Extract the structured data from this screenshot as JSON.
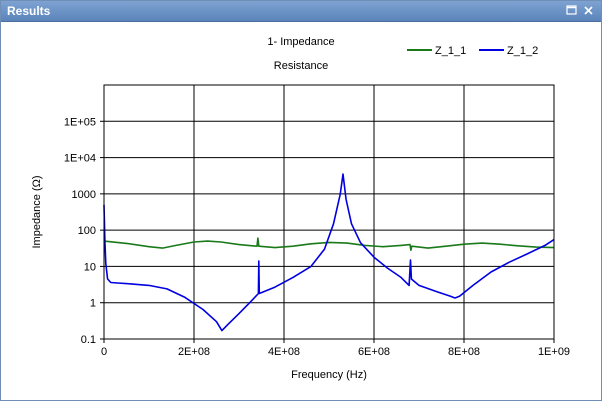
{
  "window": {
    "title": "Results"
  },
  "chart_data": {
    "type": "line",
    "title": "1- Impedance",
    "subtitle": "Resistance",
    "xlabel": "Frequency (Hz)",
    "ylabel": "Impedance (Ω)",
    "xlim": [
      0,
      1000000000
    ],
    "ylim": [
      0.1,
      1000000
    ],
    "yscale": "log",
    "grid": true,
    "legend_position": "top-right",
    "x_ticks": [
      {
        "value": 0,
        "label": "0"
      },
      {
        "value": 200000000,
        "label": "2E+08"
      },
      {
        "value": 400000000,
        "label": "4E+08"
      },
      {
        "value": 600000000,
        "label": "6E+08"
      },
      {
        "value": 800000000,
        "label": "8E+08"
      },
      {
        "value": 1000000000,
        "label": "1E+09"
      }
    ],
    "y_ticks": [
      {
        "value": 0.1,
        "label": "0.1"
      },
      {
        "value": 1,
        "label": "1"
      },
      {
        "value": 10,
        "label": "10"
      },
      {
        "value": 100,
        "label": "100"
      },
      {
        "value": 1000,
        "label": "1000"
      },
      {
        "value": 10000,
        "label": "1E+04"
      },
      {
        "value": 100000,
        "label": "1E+05"
      }
    ],
    "series": [
      {
        "name": "Z_1_1",
        "color": "#1a7a1a",
        "points": [
          [
            0,
            50
          ],
          [
            50000000,
            43
          ],
          [
            100000000,
            35
          ],
          [
            130000000,
            32
          ],
          [
            160000000,
            38
          ],
          [
            200000000,
            47
          ],
          [
            230000000,
            50
          ],
          [
            260000000,
            47
          ],
          [
            300000000,
            40
          ],
          [
            340000000,
            36
          ],
          [
            342000000,
            60
          ],
          [
            344000000,
            36
          ],
          [
            380000000,
            33
          ],
          [
            420000000,
            36
          ],
          [
            460000000,
            42
          ],
          [
            500000000,
            46
          ],
          [
            540000000,
            44
          ],
          [
            580000000,
            38
          ],
          [
            620000000,
            35
          ],
          [
            660000000,
            38
          ],
          [
            680000000,
            40
          ],
          [
            682000000,
            28
          ],
          [
            684000000,
            36
          ],
          [
            720000000,
            32
          ],
          [
            760000000,
            36
          ],
          [
            800000000,
            41
          ],
          [
            840000000,
            44
          ],
          [
            880000000,
            41
          ],
          [
            920000000,
            37
          ],
          [
            960000000,
            34
          ],
          [
            1000000000,
            33
          ]
        ]
      },
      {
        "name": "Z_1_2",
        "color": "#0000e0",
        "points": [
          [
            0,
            500
          ],
          [
            2000000,
            50
          ],
          [
            4000000,
            12
          ],
          [
            8000000,
            4.5
          ],
          [
            15000000,
            3.6
          ],
          [
            30000000,
            3.5
          ],
          [
            60000000,
            3.3
          ],
          [
            100000000,
            3.0
          ],
          [
            140000000,
            2.4
          ],
          [
            180000000,
            1.4
          ],
          [
            220000000,
            0.65
          ],
          [
            250000000,
            0.3
          ],
          [
            262000000,
            0.17
          ],
          [
            275000000,
            0.25
          ],
          [
            300000000,
            0.5
          ],
          [
            330000000,
            1.2
          ],
          [
            343000000,
            1.8
          ],
          [
            344000000,
            14
          ],
          [
            345000000,
            1.8
          ],
          [
            380000000,
            2.7
          ],
          [
            420000000,
            5
          ],
          [
            460000000,
            10
          ],
          [
            490000000,
            30
          ],
          [
            510000000,
            150
          ],
          [
            525000000,
            1000
          ],
          [
            531000000,
            3500
          ],
          [
            538000000,
            700
          ],
          [
            550000000,
            150
          ],
          [
            570000000,
            45
          ],
          [
            600000000,
            18
          ],
          [
            630000000,
            9
          ],
          [
            660000000,
            5
          ],
          [
            678000000,
            3
          ],
          [
            681000000,
            15
          ],
          [
            683000000,
            4.5
          ],
          [
            700000000,
            3.0
          ],
          [
            740000000,
            2.0
          ],
          [
            770000000,
            1.5
          ],
          [
            780000000,
            1.35
          ],
          [
            790000000,
            1.5
          ],
          [
            820000000,
            3
          ],
          [
            860000000,
            7
          ],
          [
            900000000,
            13
          ],
          [
            940000000,
            22
          ],
          [
            980000000,
            38
          ],
          [
            1000000000,
            55
          ]
        ]
      }
    ]
  }
}
